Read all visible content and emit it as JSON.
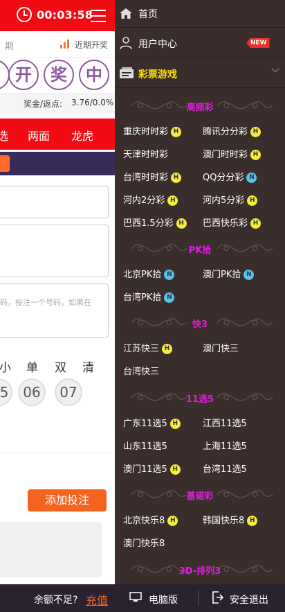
{
  "app": {
    "timer": "00:03:58",
    "period_fragment": "期",
    "recent_draws": "近期开奖",
    "draw_result_chars": [
      "开",
      "奖",
      "中"
    ],
    "bonus_label": "奖金/返点:",
    "bonus_value": "3.76/0.0%",
    "play_tabs": [
      "选",
      "两面",
      "龙虎"
    ],
    "bet_placeholder": "码，投注一个号码，如果在",
    "quick_picks": [
      "小",
      "单",
      "双",
      "清"
    ],
    "number_balls": [
      "5",
      "06",
      "07"
    ],
    "add_bet_label": "添加投注"
  },
  "menu": {
    "home": "首页",
    "user_center": "用户中心",
    "new_badge": "NEW",
    "lottery_games": "彩票游戏",
    "categories": [
      {
        "title": "高频彩",
        "items": [
          {
            "name": "重庆时时彩",
            "badge": "H"
          },
          {
            "name": "腾讯分分彩",
            "badge": "H"
          },
          {
            "name": "天津时时彩",
            "badge": ""
          },
          {
            "name": "澳门时时彩",
            "badge": "H"
          },
          {
            "name": "台湾时时彩",
            "badge": "H"
          },
          {
            "name": "QQ分分彩",
            "badge": "N"
          },
          {
            "name": "河内2分彩",
            "badge": "H"
          },
          {
            "name": "河内5分彩",
            "badge": "H"
          },
          {
            "name": "巴西1.5分彩",
            "badge": "H"
          },
          {
            "name": "巴西快乐彩",
            "badge": "H"
          }
        ]
      },
      {
        "title": "PK拾",
        "items": [
          {
            "name": "北京PK拾",
            "badge": "N"
          },
          {
            "name": "澳门PK拾",
            "badge": "N"
          },
          {
            "name": "台湾PK拾",
            "badge": "N"
          }
        ]
      },
      {
        "title": "快3",
        "items": [
          {
            "name": "江苏快三",
            "badge": "H"
          },
          {
            "name": "澳门快三",
            "badge": ""
          },
          {
            "name": "台湾快三",
            "badge": ""
          }
        ]
      },
      {
        "title": "11选5",
        "items": [
          {
            "name": "广东11选5",
            "badge": "H"
          },
          {
            "name": "江西11选5",
            "badge": ""
          },
          {
            "name": "山东11选5",
            "badge": ""
          },
          {
            "name": "上海11选5",
            "badge": ""
          },
          {
            "name": "澳门11选5",
            "badge": "H"
          },
          {
            "name": "台湾11选5",
            "badge": ""
          }
        ]
      },
      {
        "title": "基诺彩",
        "items": [
          {
            "name": "北京快乐8",
            "badge": "H"
          },
          {
            "name": "韩国快乐8",
            "badge": "H"
          },
          {
            "name": "澳门快乐8",
            "badge": ""
          }
        ]
      },
      {
        "title": "3D-排列3",
        "items": []
      }
    ]
  },
  "bottom": {
    "insufficient": "余额不足?",
    "top_up": "充值",
    "pc_version": "电脑版",
    "logout": "安全退出"
  },
  "colors": {
    "primary_red": "#f10c14",
    "menu_bg": "#3a2e2c",
    "category_title": "#e11cde",
    "games_title": "#ffe000",
    "hot_badge": "#f7ec3b",
    "new_badge": "#56c4f0",
    "accent_orange": "#f5641f"
  }
}
